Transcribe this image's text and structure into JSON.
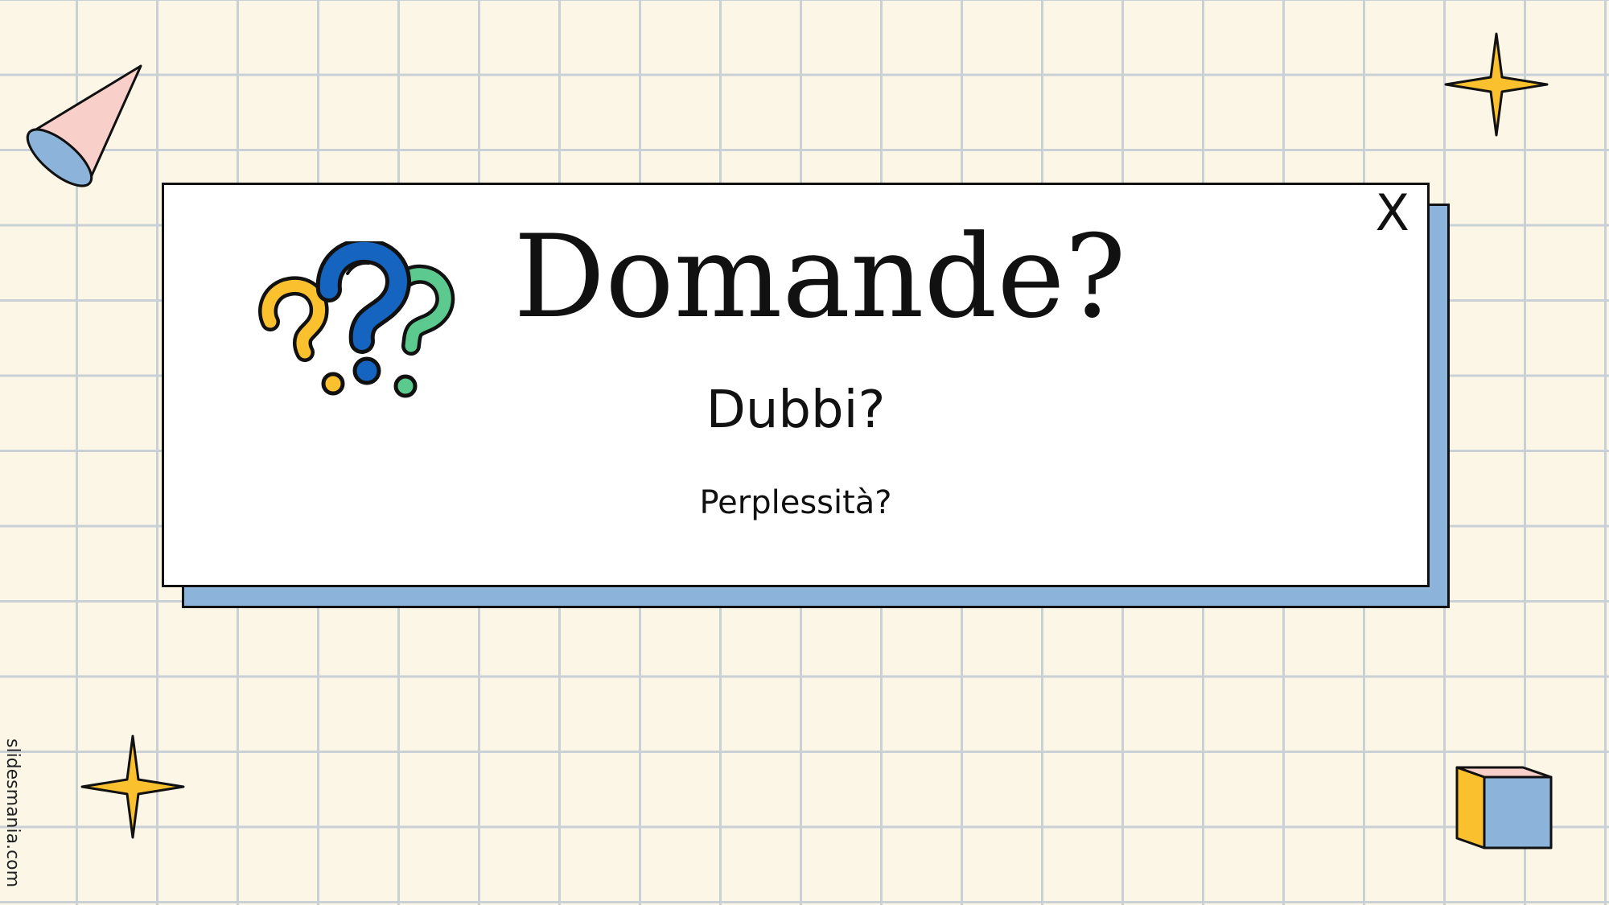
{
  "slide": {
    "title": "Domande?",
    "subtitle": "Dubbi?",
    "subtitle2": "Perplessità?",
    "close_label": "X",
    "watermark": "slidesmania.com"
  },
  "colors": {
    "background": "#fbf6e6",
    "grid": "#c9d0d6",
    "shadow": "#8cb4da",
    "yellow": "#fbc02d",
    "blue": "#1565c0",
    "green": "#5cc98e",
    "pink": "#f8cfc9",
    "light_blue": "#8cb4da"
  },
  "icons": {
    "question_marks": "question-marks-icon",
    "cone": "cone-icon",
    "sparkles": "sparkle-icon",
    "cube": "cube-icon",
    "close": "close-icon"
  }
}
